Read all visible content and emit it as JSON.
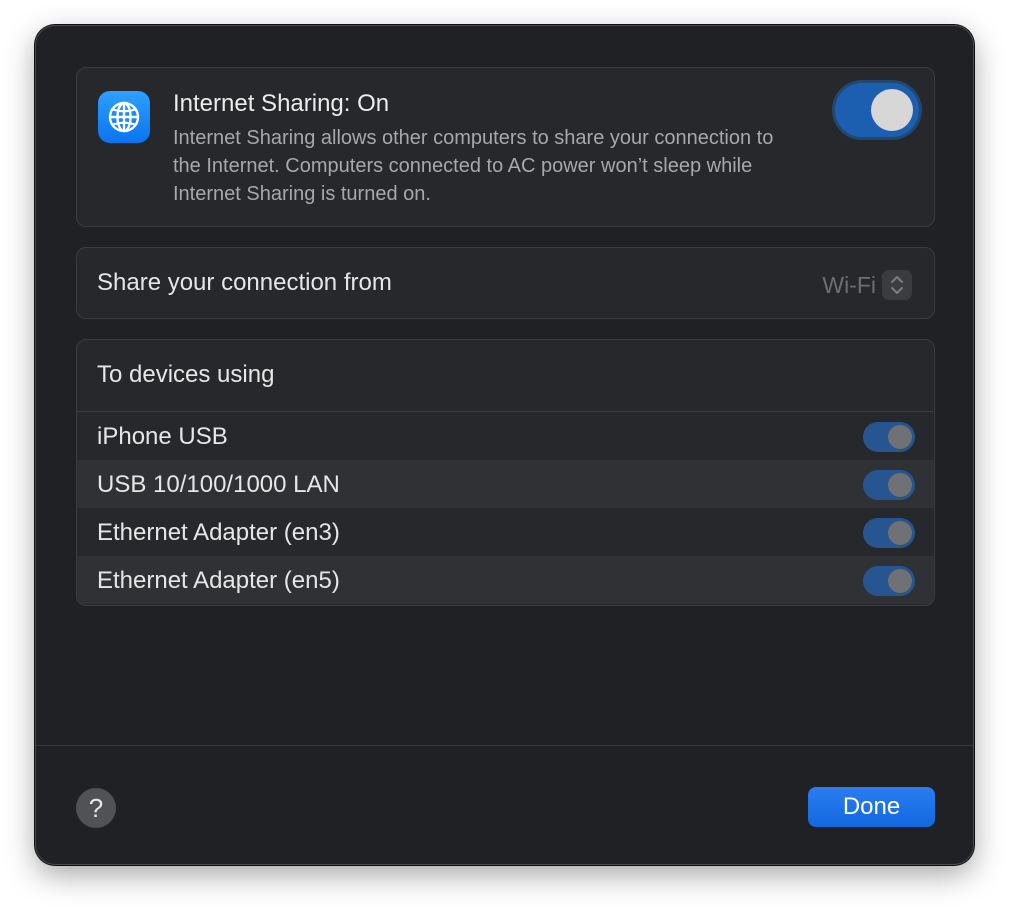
{
  "sharing": {
    "title": "Internet Sharing: On",
    "description": "Internet Sharing allows other computers to share your connection to the Internet. Computers connected to AC power won’t sleep while Internet Sharing is turned on.",
    "icon": "globe-icon",
    "enabled": true
  },
  "source": {
    "label": "Share your connection from",
    "selected": "Wi-Fi"
  },
  "devices": {
    "header": "To devices using",
    "items": [
      {
        "label": "iPhone USB",
        "enabled": true
      },
      {
        "label": "USB 10/100/1000 LAN",
        "enabled": true
      },
      {
        "label": "Ethernet Adapter (en3)",
        "enabled": true
      },
      {
        "label": "Ethernet Adapter (en5)",
        "enabled": true
      }
    ]
  },
  "footer": {
    "help_label": "?",
    "done_label": "Done"
  },
  "colors": {
    "accent": "#1368e0",
    "background": "#1f2124",
    "card": "#26282b"
  }
}
